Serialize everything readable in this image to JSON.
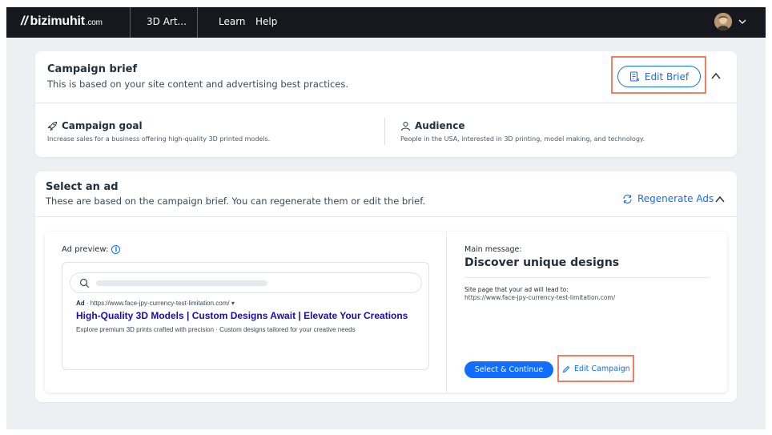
{
  "topbar": {
    "logo_text": "bizimuhit",
    "logo_tld": ".com",
    "site_name": "3D Art...",
    "nav": {
      "learn": "Learn",
      "help": "Help"
    }
  },
  "campaign_brief": {
    "title": "Campaign brief",
    "subtitle": "This is based on your site content and advertising best practices.",
    "edit_button": "Edit Brief",
    "goal": {
      "label": "Campaign goal",
      "text": "Increase sales for a business offering high-quality 3D printed models."
    },
    "audience": {
      "label": "Audience",
      "text": "People in the USA, interested in 3D printing, model making, and technology."
    }
  },
  "select_ad": {
    "title": "Select an ad",
    "subtitle": "These are based on the campaign brief. You can regenerate them or edit the brief.",
    "regenerate_label": "Regenerate Ads",
    "preview": {
      "label": "Ad preview:",
      "ad_tag": "Ad",
      "url": "https://www.face-jpy-currency-test-limitation.com/",
      "headline": "High-Quality 3D Models | Custom Designs Await | Elevate Your Creations",
      "description": "Explore premium 3D prints crafted with precision · Custom designs tailored for your creative needs"
    },
    "main_message_label": "Main message:",
    "main_message": "Discover unique designs",
    "lead_label": "Site page that your ad will lead to:",
    "lead_url": "https://www.face-jpy-currency-test-limitation.com/",
    "select_button": "Select & Continue",
    "edit_campaign_button": "Edit Campaign"
  },
  "colors": {
    "accent": "#116dff",
    "highlight": "#f07f63",
    "topbar": "#16181d",
    "background": "#edeff2",
    "ad_headline": "#1a0dab"
  }
}
